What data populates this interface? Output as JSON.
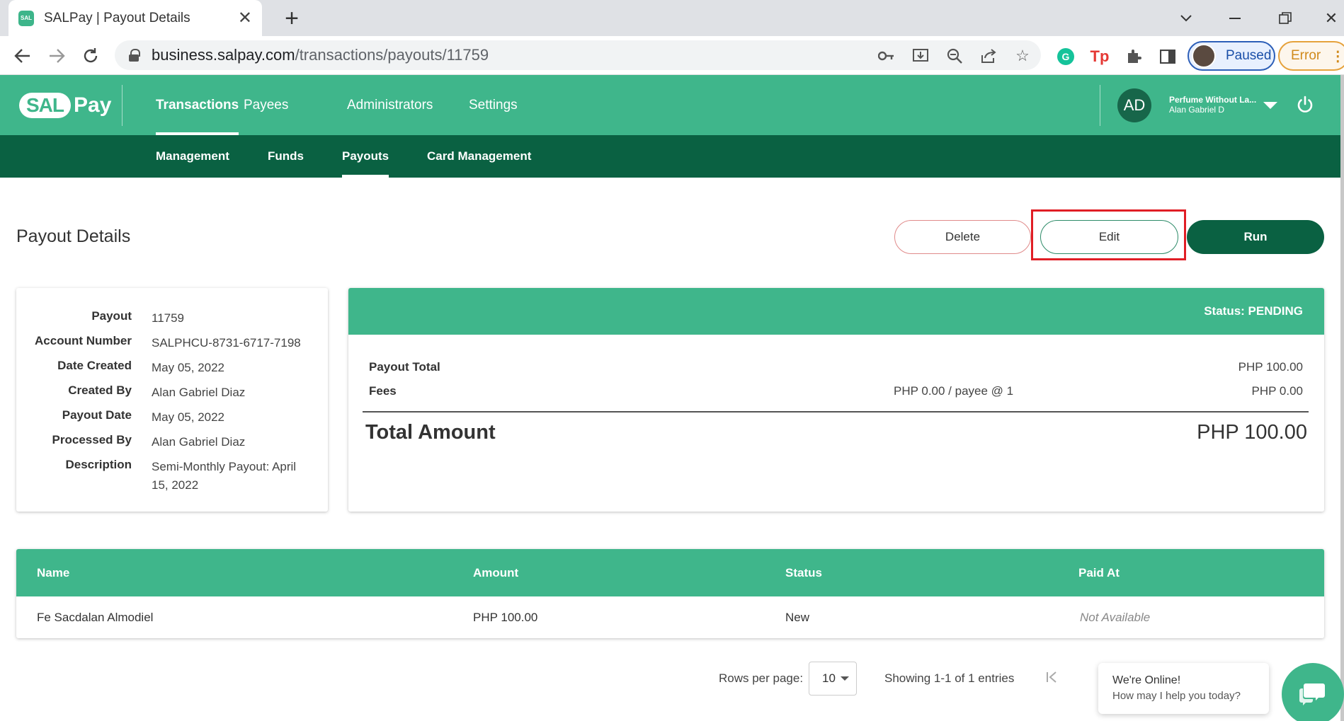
{
  "browser": {
    "tab_title": "SALPay | Payout Details",
    "tab_favicon_text": "SAL",
    "url_host": "business.salpay.com",
    "url_path": "/transactions/payouts/11759",
    "profile_label": "Paused",
    "error_label": "Error",
    "icons": [
      "back-icon",
      "forward-icon",
      "reload-icon",
      "key-icon",
      "install-icon",
      "zoom-out-icon",
      "share-icon",
      "star-icon",
      "grammarly-icon",
      "tp-icon",
      "extensions-icon",
      "side-panel-icon",
      "kebab-icon"
    ]
  },
  "app": {
    "logo_left": "SAL",
    "logo_right": "Pay",
    "main_nav": [
      "Transactions",
      "Payees",
      "Administrators",
      "Settings"
    ],
    "active_main": "Transactions",
    "sub_nav": [
      "Management",
      "Funds",
      "Payouts",
      "Card Management"
    ],
    "active_sub": "Payouts",
    "user": {
      "initials": "AD",
      "company": "Perfume Without La...",
      "name": "Alan Gabriel D"
    }
  },
  "page": {
    "title": "Payout Details",
    "buttons": {
      "delete": "Delete",
      "edit": "Edit",
      "run": "Run"
    }
  },
  "details": [
    {
      "label": "Payout",
      "value": "11759"
    },
    {
      "label": "Account Number",
      "value": "SALPHCU-8731-6717-7198"
    },
    {
      "label": "Date Created",
      "value": "May 05, 2022"
    },
    {
      "label": "Created By",
      "value": "Alan Gabriel Diaz"
    },
    {
      "label": "Payout Date",
      "value": "May 05, 2022"
    },
    {
      "label": "Processed By",
      "value": "Alan Gabriel Diaz"
    },
    {
      "label": "Description",
      "value": "Semi-Monthly Payout: April 15, 2022"
    }
  ],
  "summary": {
    "status": "Status: PENDING",
    "payout_total_label": "Payout Total",
    "payout_total_value": "PHP 100.00",
    "fees_label": "Fees",
    "fees_detail": "PHP 0.00 / payee @ 1",
    "fees_value": "PHP 0.00",
    "total_label": "Total Amount",
    "total_value": "PHP 100.00"
  },
  "table": {
    "columns": [
      "Name",
      "Amount",
      "Status",
      "Paid At"
    ],
    "rows": [
      [
        "Fe Sacdalan Almodiel",
        "PHP 100.00",
        "New",
        "Not Available"
      ]
    ]
  },
  "pagination": {
    "rows_label": "Rows per page:",
    "rows_value": "10",
    "showing": "Showing 1-1 of 1 entries"
  },
  "chat": {
    "title": "We're Online!",
    "subtitle": "How may I help you today?"
  },
  "colors": {
    "brand_green": "#3fb68b",
    "dark_green": "#0a6142",
    "highlight_red": "#e01e25"
  }
}
